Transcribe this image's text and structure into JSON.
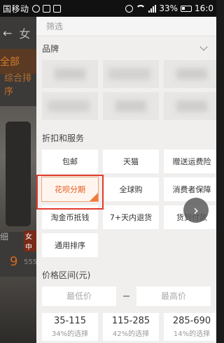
{
  "status_bar": {
    "carrier": "国移动",
    "battery": "33%",
    "time": "16:0"
  },
  "background_app": {
    "back_label": "←",
    "search_prefix": "女",
    "tab_all": "全部",
    "tab_sort": "综合排序",
    "item_title": "细",
    "item_badge": "女中",
    "item_price": "9",
    "item_sales": "555"
  },
  "drawer": {
    "title": "筛选",
    "brand": {
      "label": "品牌",
      "items": [
        "",
        "",
        "",
        "",
        "",
        ""
      ]
    },
    "services": {
      "label": "折扣和服务",
      "options": [
        {
          "label": "包邮",
          "selected": false
        },
        {
          "label": "天猫",
          "selected": false
        },
        {
          "label": "赠送运费险",
          "selected": false
        },
        {
          "label": "花呗分期",
          "selected": true
        },
        {
          "label": "全球购",
          "selected": false
        },
        {
          "label": "消费者保障",
          "selected": false
        },
        {
          "label": "淘金币抵钱",
          "selected": false
        },
        {
          "label": "7+天内退货",
          "selected": false
        },
        {
          "label": "货到付款",
          "selected": false
        },
        {
          "label": "通用排序",
          "selected": false
        }
      ]
    },
    "price": {
      "label": "价格区间(元)",
      "min_placeholder": "最低价",
      "max_placeholder": "最高价",
      "ranges": [
        {
          "value": "35-115",
          "pct": "34%的选择"
        },
        {
          "value": "115-285",
          "pct": "42%的选择"
        },
        {
          "value": "285-690",
          "pct": "14%的选择"
        }
      ]
    }
  },
  "fab_icon": "chevron-right-icon",
  "accent_color": "#e8591a",
  "highlight_color": "#e23b2c"
}
